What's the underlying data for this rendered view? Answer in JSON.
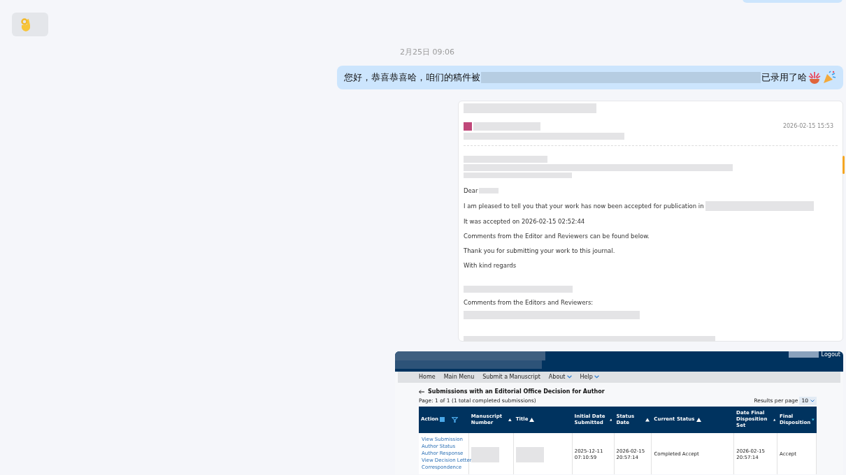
{
  "messages": [
    {
      "kind": "sticker",
      "outgoing": false
    },
    {
      "kind": "time",
      "text": "2月25日 09:06"
    },
    {
      "kind": "text",
      "outgoing": true,
      "parts": [
        {
          "kind": "text",
          "text": "您好，恭喜恭喜哈，咱们的稿件被"
        },
        {
          "kind": "redacted"
        },
        {
          "kind": "text",
          "text": "已录用了哈"
        },
        {
          "kind": "confetti"
        },
        {
          "kind": "popper"
        }
      ]
    },
    {
      "kind": "email",
      "outgoing": true
    },
    {
      "kind": "table",
      "outgoing": true
    }
  ],
  "email": {
    "timestamp": "2026-02-15 15:53",
    "lines": [
      {
        "text": "Dear",
        "redacted_tail": true
      },
      {
        "text": "I am pleased to tell you that your work has now been accepted for publication in",
        "redacted_tail": true
      },
      {
        "text": "It was accepted on 2026-02-15 02:52:44",
        "redacted_tail": false
      },
      {
        "text": "Comments from the Editor and Reviewers can be found below.",
        "redacted_tail": false
      },
      {
        "text": "Thank you for submitting your work to this journal.",
        "redacted_tail": false
      },
      {
        "text": "With kind regards",
        "redacted_tail": false
      }
    ],
    "comments_heading": "Comments from the Editors and Reviewers:"
  },
  "portal": {
    "logout": "Logout",
    "nav": [
      {
        "label": "Home",
        "dropdown": false
      },
      {
        "label": "Main Menu",
        "dropdown": false
      },
      {
        "label": "Submit a Manuscript",
        "dropdown": false
      },
      {
        "label": "About",
        "dropdown": true
      },
      {
        "label": "Help",
        "dropdown": true
      }
    ],
    "heading": "Submissions with an Editorial Office Decision for Author",
    "page_info": "Page: 1 of 1 (1 total completed submissions)",
    "results_label": "Results per page",
    "results_value": "10",
    "columns": [
      {
        "label": "Action",
        "sortable": false
      },
      {
        "label": "Manuscript Number",
        "sortable": true,
        "sort_active": false
      },
      {
        "label": "Title",
        "sortable": true,
        "sort_active": false
      },
      {
        "label": "Initial Date Submitted",
        "sortable": true,
        "sort_active": false
      },
      {
        "label": "Status Date",
        "sortable": true,
        "sort_active": false
      },
      {
        "label": "Current Status",
        "sortable": true,
        "sort_active": false
      },
      {
        "label": "Date Final Disposition Set",
        "sortable": true,
        "sort_active": false
      },
      {
        "label": "Final Disposition",
        "sortable": true,
        "sort_active": true
      }
    ],
    "row": {
      "actions": [
        "View Submission",
        "Author Status",
        "Author Response",
        "View Decision Letter",
        "Correspondence"
      ],
      "cells": [
        {
          "kind": "redacted"
        },
        {
          "kind": "redacted"
        },
        {
          "kind": "text",
          "text": "2025-12-11 07:10:59"
        },
        {
          "kind": "text",
          "text": "2026-02-15 20:57:14"
        },
        {
          "kind": "text",
          "text": "Completed Accept"
        },
        {
          "kind": "text",
          "text": "2026-02-15 20:57:14"
        },
        {
          "kind": "text",
          "text": "Accept"
        }
      ]
    }
  }
}
